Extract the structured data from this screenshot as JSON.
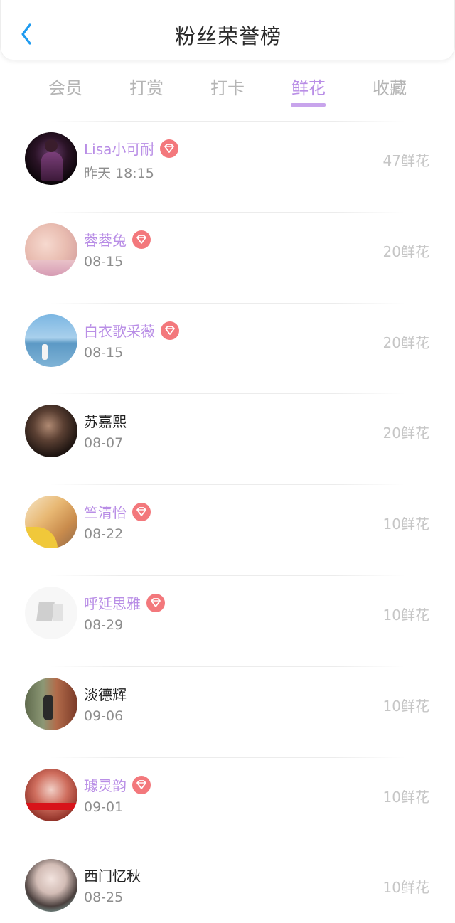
{
  "header": {
    "title": "粉丝荣誉榜"
  },
  "tabs": [
    {
      "label": "会员",
      "active": false
    },
    {
      "label": "打赏",
      "active": false
    },
    {
      "label": "打卡",
      "active": false
    },
    {
      "label": "鲜花",
      "active": true
    },
    {
      "label": "收藏",
      "active": false
    }
  ],
  "colors": {
    "accent": "#b98ee6",
    "vip_badge": "#f3787c",
    "back_arrow": "#1e9bf0",
    "count_text": "#c6c6c6",
    "date_text": "#8d8d8d"
  },
  "fans": [
    {
      "name": "Lisa小可耐",
      "vip": true,
      "date": "昨天 18:15",
      "count": "47鲜花"
    },
    {
      "name": "蓉蓉兔",
      "vip": true,
      "date": "08-15",
      "count": "20鲜花"
    },
    {
      "name": "白衣歌采薇",
      "vip": true,
      "date": "08-15",
      "count": "20鲜花"
    },
    {
      "name": "苏嘉熙",
      "vip": false,
      "date": "08-07",
      "count": "20鲜花"
    },
    {
      "name": "竺清怡",
      "vip": true,
      "date": "08-22",
      "count": "10鲜花"
    },
    {
      "name": "呼延思雅",
      "vip": true,
      "date": "08-29",
      "count": "10鲜花"
    },
    {
      "name": "淡德辉",
      "vip": false,
      "date": "09-06",
      "count": "10鲜花"
    },
    {
      "name": "璩灵韵",
      "vip": true,
      "date": "09-01",
      "count": "10鲜花"
    },
    {
      "name": "西门忆秋",
      "vip": false,
      "date": "08-25",
      "count": "10鲜花"
    }
  ]
}
